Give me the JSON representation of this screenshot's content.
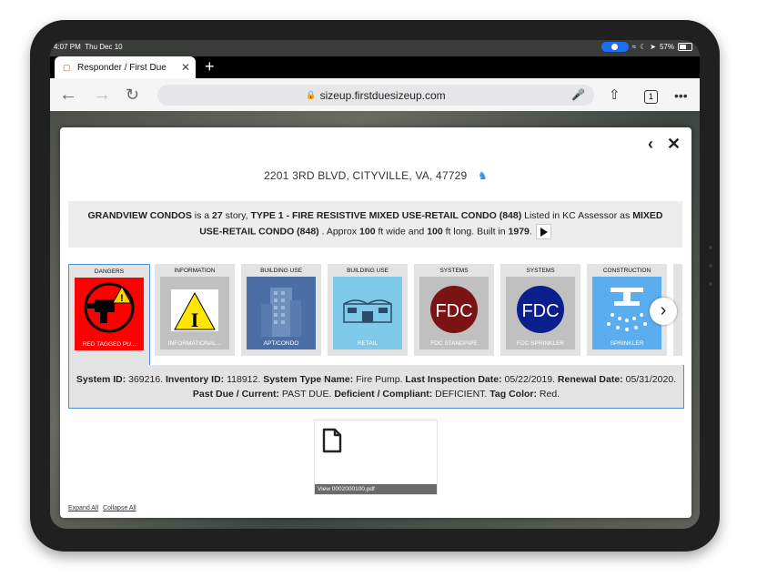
{
  "status_bar": {
    "time": "4:07 PM",
    "date": "Thu Dec 10",
    "battery": "57%"
  },
  "browser": {
    "tab_title": "Responder / First Due",
    "url": "sizeup.firstduesizeup.com",
    "tab_count": "1"
  },
  "property": {
    "address": "2201 3RD BLVD, CITYVILLE, VA, 47729",
    "summary_parts": [
      {
        "text": "GRANDVIEW CONDOS",
        "bold": true
      },
      {
        "text": " is a ",
        "bold": false
      },
      {
        "text": "27",
        "bold": true
      },
      {
        "text": " story, ",
        "bold": false
      },
      {
        "text": "TYPE 1 - FIRE RESISTIVE MIXED USE-RETAIL CONDO (848)",
        "bold": true
      },
      {
        "text": " Listed in KC Assessor as ",
        "bold": false
      },
      {
        "text": "MIXED USE-RETAIL CONDO (848)",
        "bold": true
      },
      {
        "text": " . Approx ",
        "bold": false
      },
      {
        "text": "100",
        "bold": true
      },
      {
        "text": " ft wide and ",
        "bold": false
      },
      {
        "text": "100",
        "bold": true
      },
      {
        "text": " ft long. Built in ",
        "bold": false
      },
      {
        "text": "1979",
        "bold": true
      },
      {
        "text": ".",
        "bold": false
      }
    ]
  },
  "cards": [
    {
      "category": "DANGERS",
      "label": "RED TAGGED PU...",
      "color": "#ff0000",
      "icon": "red-tagged-pump-icon"
    },
    {
      "category": "INFORMATION",
      "label": "INFORMATIONAL...",
      "color": "#c0c0c0",
      "icon": "information-triangle-icon"
    },
    {
      "category": "BUILDING USE",
      "label": "APT/CONDO",
      "color": "#4a6fa5",
      "icon": "apartment-building-icon"
    },
    {
      "category": "BUILDING USE",
      "label": "RETAIL",
      "color": "#7ec8ea",
      "icon": "retail-store-icon"
    },
    {
      "category": "SYSTEMS",
      "label": "FDC STANDPIPE",
      "color": "#c0c0c0",
      "icon": "fdc-standpipe-icon",
      "badge": "FDC",
      "badge_color": "#7a1414"
    },
    {
      "category": "SYSTEMS",
      "label": "FDC SPRINKLER",
      "color": "#c0c0c0",
      "icon": "fdc-sprinkler-icon",
      "badge": "FDC",
      "badge_color": "#0a1f8c"
    },
    {
      "category": "CONSTRUCTION",
      "label": "SPRINKLER",
      "color": "#5aaef0",
      "icon": "sprinkler-icon"
    }
  ],
  "detail_parts": [
    {
      "text": "System ID:",
      "bold": true
    },
    {
      "text": " 369216. ",
      "bold": false
    },
    {
      "text": "Inventory ID:",
      "bold": true
    },
    {
      "text": " 118912. ",
      "bold": false
    },
    {
      "text": "System Type Name:",
      "bold": true
    },
    {
      "text": " Fire Pump. ",
      "bold": false
    },
    {
      "text": "Last Inspection Date:",
      "bold": true
    },
    {
      "text": " 05/22/2019. ",
      "bold": false
    },
    {
      "text": "Renewal Date:",
      "bold": true
    },
    {
      "text": " 05/31/2020. ",
      "bold": false
    },
    {
      "text": "Past Due / Current:",
      "bold": true
    },
    {
      "text": " PAST DUE. ",
      "bold": false
    },
    {
      "text": "Deficient / Compliant:",
      "bold": true
    },
    {
      "text": " DEFICIENT. ",
      "bold": false
    },
    {
      "text": "Tag Color:",
      "bold": true
    },
    {
      "text": " Red.",
      "bold": false
    }
  ],
  "attachment": {
    "filename": "View 0002000100.pdf"
  },
  "footer": {
    "expand_all": "Expand All",
    "collapse_all": "Collapse All"
  }
}
